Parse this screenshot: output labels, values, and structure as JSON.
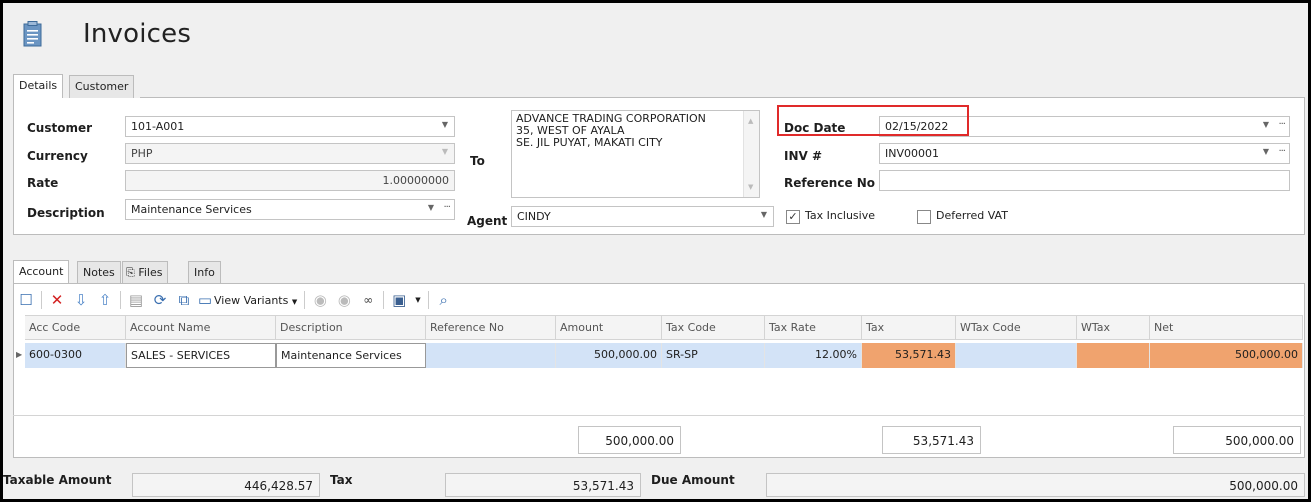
{
  "window": {
    "title": "Invoices",
    "icon": "invoice-icon"
  },
  "tabs": [
    {
      "label": "Details",
      "active": true
    },
    {
      "label": "Customer",
      "active": false
    }
  ],
  "details": {
    "customer_label": "Customer",
    "customer_value": "101-A001",
    "currency_label": "Currency",
    "currency_value": "PHP",
    "rate_label": "Rate",
    "rate_value": "1.00000000",
    "description_label": "Description",
    "description_value": "Maintenance Services",
    "to_label": "To",
    "to_lines": [
      "ADVANCE TRADING CORPORATION",
      "35, WEST OF AYALA",
      "SE. JIL PUYAT, MAKATI CITY"
    ],
    "agent_label": "Agent",
    "agent_value": "CINDY",
    "docdate_label": "Doc Date",
    "docdate_value": "02/15/2022",
    "inv_label": "INV #",
    "inv_value": "INV00001",
    "refno_label": "Reference No",
    "refno_value": "",
    "tax_inclusive_label": "Tax Inclusive",
    "tax_inclusive_checked": true,
    "deferred_vat_label": "Deferred VAT",
    "deferred_vat_checked": false
  },
  "subtabs": [
    {
      "label": "Account",
      "active": true
    },
    {
      "label": "Notes",
      "active": false
    },
    {
      "label": "Files",
      "active": false
    },
    {
      "label": "Info",
      "active": false
    }
  ],
  "toolbar": {
    "view_variants_label": "View Variants",
    "icons": [
      "new-row-icon",
      "delete-icon",
      "move-down-icon",
      "move-up-icon",
      "grid-icon",
      "refresh-icon",
      "export-icon",
      "view-variants-icon",
      "up-icon",
      "down-icon",
      "find-icon",
      "save-icon",
      "preview-icon"
    ]
  },
  "grid": {
    "columns": [
      "Acc Code",
      "Account Name",
      "Description",
      "Reference No",
      "Amount",
      "Tax Code",
      "Tax Rate",
      "Tax",
      "WTax Code",
      "WTax",
      "Net"
    ],
    "rows": [
      [
        "600-0300",
        "SALES - SERVICES",
        "Maintenance Services",
        "",
        "500,000.00",
        "SR-SP",
        "12.00%",
        "53,571.43",
        "",
        "",
        "500,000.00"
      ]
    ],
    "totals": {
      "amount": "500,000.00",
      "tax": "53,571.43",
      "net": "500,000.00"
    }
  },
  "footer": {
    "taxable_label": "Taxable Amount",
    "taxable_value": "446,428.57",
    "tax_label": "Tax",
    "tax_value": "53,571.43",
    "due_label": "Due Amount",
    "due_value": "500,000.00"
  },
  "colors": {
    "highlight": "#e02a2a",
    "selected_row": "#d3e3f7",
    "orange_cell": "#f0a36e"
  }
}
